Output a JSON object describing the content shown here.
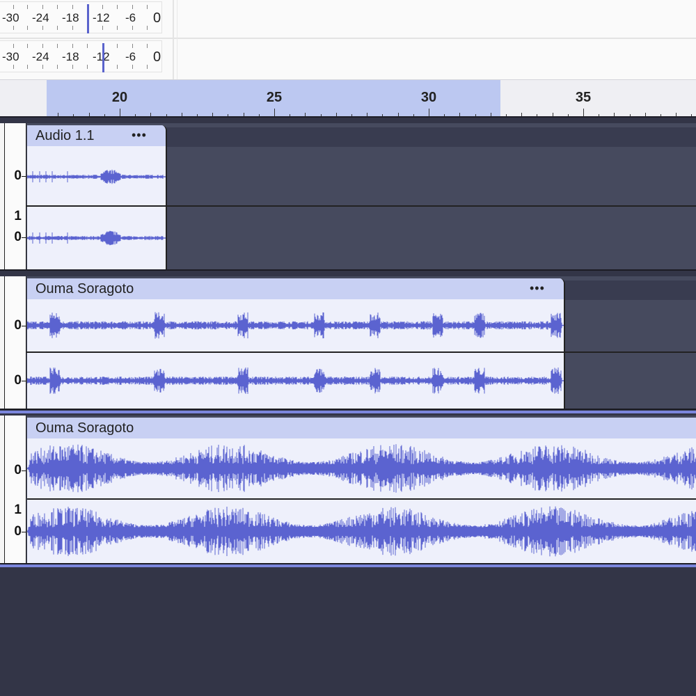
{
  "meters": {
    "record": {
      "labels": [
        "-30",
        "-24",
        "-18",
        "-12",
        "-6",
        "0"
      ],
      "level_db": -13
    },
    "playback": {
      "labels": [
        "-30",
        "-24",
        "-18",
        "-12",
        "-6",
        "0"
      ],
      "level_db": -10
    }
  },
  "ruler": {
    "labels": [
      "20",
      "25",
      "30",
      "35"
    ],
    "selection": {
      "start": 17.8,
      "end": 32.4
    }
  },
  "tracks": [
    {
      "clip_title": "Audio 1.1",
      "clip_menu": "•••",
      "channels": [
        {
          "scale_labels": [
            "0"
          ]
        },
        {
          "scale_labels": [
            "1",
            "0"
          ]
        }
      ],
      "selected": false
    },
    {
      "clip_title": "Ouma Soragoto",
      "clip_menu": "•••",
      "channels": [
        {
          "scale_labels": [
            "0"
          ]
        },
        {
          "scale_labels": [
            "0"
          ]
        }
      ],
      "selected": false
    },
    {
      "clip_title": "Ouma Soragoto",
      "clip_menu": "",
      "channels": [
        {
          "scale_labels": [
            "0"
          ]
        },
        {
          "scale_labels": [
            "1",
            "0"
          ]
        }
      ],
      "selected": true
    }
  ],
  "colors": {
    "waveform": "#5b63d0",
    "clip_body": "#eef0fb",
    "clip_header": "#c8d0f3",
    "selection": "#bcc8f1",
    "background": "#333547"
  }
}
